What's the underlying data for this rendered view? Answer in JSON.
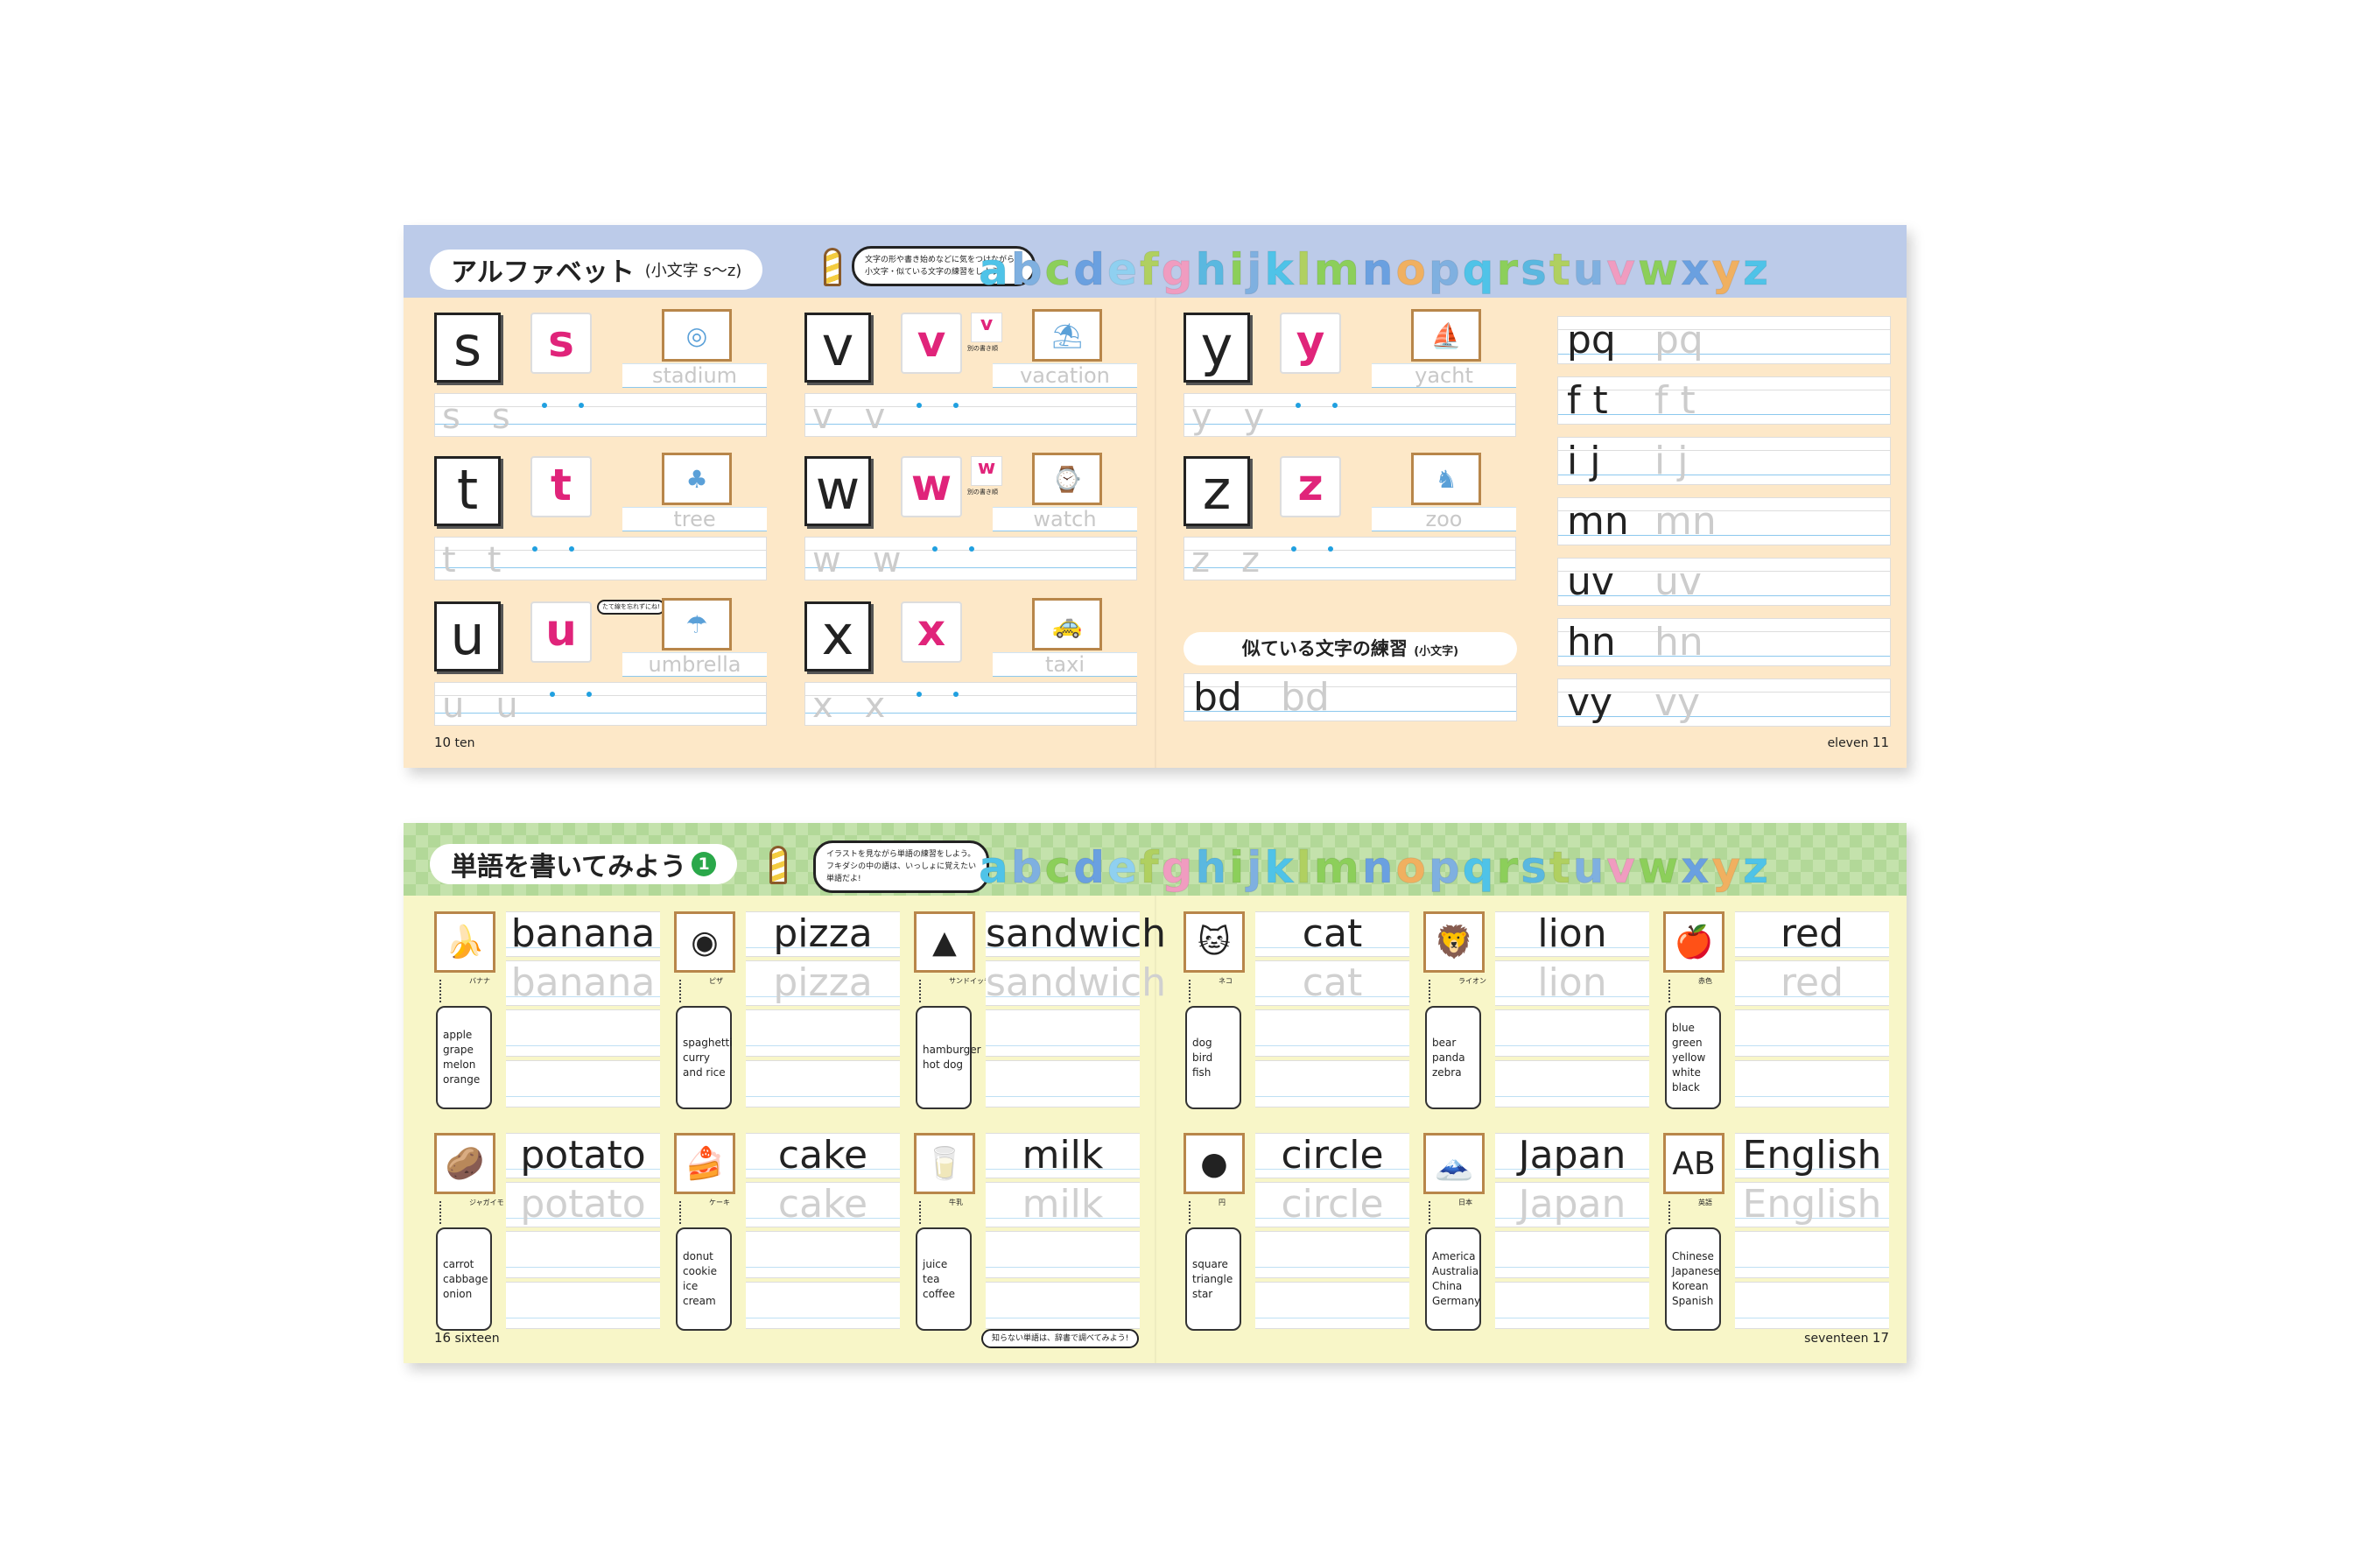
{
  "top_spread": {
    "title": "アルファベット",
    "subtitle": "(小文字 s〜z)",
    "speech": [
      "文字の形や書き始めなどに気をつけながら、",
      "小文字・似ている文字の練習をしよう!"
    ],
    "alphabet": [
      "a",
      "b",
      "c",
      "d",
      "e",
      "f",
      "g",
      "h",
      "i",
      "j",
      "k",
      "l",
      "m",
      "n",
      "o",
      "p",
      "q",
      "r",
      "s",
      "t",
      "u",
      "v",
      "w",
      "x",
      "y",
      "z"
    ],
    "alphabet_colors": [
      "#4fc3e8",
      "#7fb0e0",
      "#8ccf5a",
      "#6aa0e0",
      "#8fd0f0",
      "#b0d060",
      "#f09cc0",
      "#5ab8e0",
      "#8ccf5a",
      "#7fb0e0",
      "#4fc3e8",
      "#b0d060",
      "#8ccf5a",
      "#6aa0e0",
      "#f0b060",
      "#7fb0e0",
      "#4fc3e8",
      "#8ccf5a",
      "#5ab8e0",
      "#b0d060",
      "#7fb0e0",
      "#f09cc0",
      "#8ccf5a",
      "#6aa0e0",
      "#f0b060",
      "#4fc3e8"
    ],
    "letters": [
      {
        "letter": "s",
        "word": "stadium",
        "icon": "stadium-icon",
        "glyph": "◎"
      },
      {
        "letter": "t",
        "word": "tree",
        "icon": "tree-icon",
        "glyph": "♣"
      },
      {
        "letter": "u",
        "word": "umbrella",
        "icon": "umbrella-icon",
        "glyph": "☂",
        "hint": "たて線を忘れずにね!"
      },
      {
        "letter": "v",
        "word": "vacation",
        "icon": "beach-umbrella-icon",
        "glyph": "⛱",
        "alt": "別の書き順"
      },
      {
        "letter": "w",
        "word": "watch",
        "icon": "watch-icon",
        "glyph": "⌚",
        "alt": "別の書き順"
      },
      {
        "letter": "x",
        "word": "taxi",
        "icon": "taxi-icon",
        "glyph": "🚕"
      },
      {
        "letter": "y",
        "word": "yacht",
        "icon": "yacht-icon",
        "glyph": "⛵"
      },
      {
        "letter": "z",
        "word": "zoo",
        "icon": "zoo-icon",
        "glyph": "♞"
      }
    ],
    "pairs": [
      "pq",
      "f t",
      "i j",
      "mn",
      "uv",
      "hn",
      "vy"
    ],
    "similar_title": "似ている文字の練習",
    "similar_sub": "(小文字)",
    "similar_pair": "bd",
    "page_left": {
      "num": "10",
      "word": "ten"
    },
    "page_right": {
      "num": "11",
      "word": "eleven"
    }
  },
  "bottom_spread": {
    "title": "単語を書いてみよう",
    "badge": "1",
    "speech": [
      "イラストを見ながら単語の練習をしよう。",
      "フキダシの中の語は、いっしょに覚えたい",
      "単語だよ!"
    ],
    "words": [
      {
        "word": "banana",
        "jp": "バナナ",
        "icon": "banana-icon",
        "glyph": "🍌",
        "related": [
          "apple",
          "grape",
          "melon",
          "orange"
        ]
      },
      {
        "word": "pizza",
        "jp": "ピザ",
        "icon": "pizza-icon",
        "glyph": "◉",
        "related": [
          "spaghetti",
          "curry",
          "and rice"
        ]
      },
      {
        "word": "sandwich",
        "jp": "サンドイッチ",
        "icon": "sandwich-icon",
        "glyph": "▲",
        "related": [
          "hamburger",
          "hot dog"
        ]
      },
      {
        "word": "cat",
        "jp": "ネコ",
        "icon": "cat-icon",
        "glyph": "🐱",
        "related": [
          "dog",
          "bird",
          "fish"
        ]
      },
      {
        "word": "lion",
        "jp": "ライオン",
        "icon": "lion-icon",
        "glyph": "🦁",
        "related": [
          "bear",
          "panda",
          "zebra"
        ]
      },
      {
        "word": "red",
        "jp": "赤色",
        "icon": "red-items-icon",
        "glyph": "🍎",
        "related": [
          "blue",
          "green",
          "yellow",
          "white",
          "black"
        ]
      },
      {
        "word": "potato",
        "jp": "ジャガイモ",
        "icon": "potato-icon",
        "glyph": "🥔",
        "related": [
          "carrot",
          "cabbage",
          "onion"
        ]
      },
      {
        "word": "cake",
        "jp": "ケーキ",
        "icon": "cake-icon",
        "glyph": "🍰",
        "related": [
          "donut",
          "cookie",
          "ice cream"
        ]
      },
      {
        "word": "milk",
        "jp": "牛乳",
        "icon": "milk-icon",
        "glyph": "🥛",
        "related": [
          "juice",
          "tea",
          "coffee"
        ]
      },
      {
        "word": "circle",
        "jp": "円",
        "icon": "circle-icon",
        "glyph": "●",
        "related": [
          "square",
          "triangle",
          "star"
        ]
      },
      {
        "word": "Japan",
        "jp": "日本",
        "icon": "japan-flag-icon",
        "glyph": "🗻",
        "related": [
          "America",
          "Australia",
          "China",
          "Germany"
        ]
      },
      {
        "word": "English",
        "jp": "英語",
        "icon": "abc-blocks-icon",
        "glyph": "AB",
        "related": [
          "Chinese",
          "Japanese",
          "Korean",
          "Spanish"
        ]
      }
    ],
    "footer_tip": "知らない単語は、辞書で調べてみよう!",
    "page_left": {
      "num": "16",
      "word": "sixteen"
    },
    "page_right": {
      "num": "17",
      "word": "seventeen"
    }
  }
}
